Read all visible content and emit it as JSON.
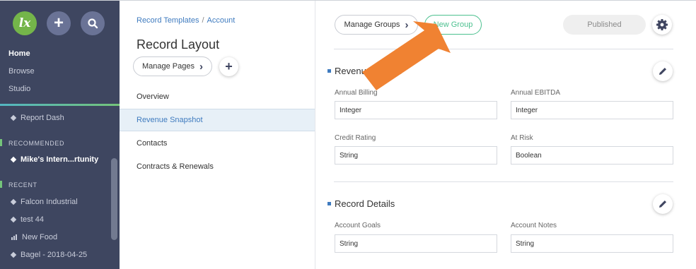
{
  "sidebar": {
    "logo_text": "lx",
    "nav": {
      "home": "Home",
      "browse": "Browse",
      "studio": "Studio"
    },
    "pinned": [
      {
        "label": "Report Dash"
      }
    ],
    "recommended_header": "RECOMMENDED",
    "recommended": [
      {
        "label": "Mike's Intern...rtunity"
      }
    ],
    "recent_header": "RECENT",
    "recent": [
      {
        "label": "Falcon Industrial",
        "icon": "diamond-icon"
      },
      {
        "label": "test 44",
        "icon": "diamond-icon"
      },
      {
        "label": "New Food",
        "icon": "bar-chart-icon"
      },
      {
        "label": "Bagel - 2018-04-25",
        "icon": "diamond-icon"
      }
    ]
  },
  "middle": {
    "breadcrumb": {
      "parent": "Record Templates",
      "separator": "/",
      "current": "Account"
    },
    "title": "Record Layout",
    "manage_pages_label": "Manage Pages",
    "pages": [
      {
        "label": "Overview"
      },
      {
        "label": "Revenue Snapshot"
      },
      {
        "label": "Contacts"
      },
      {
        "label": "Contracts & Renewals"
      }
    ],
    "selected_page": "Revenue Snapshot"
  },
  "main": {
    "manage_groups_label": "Manage Groups",
    "new_group_label": "New Group",
    "published_label": "Published",
    "groups": [
      {
        "title": "Revenue Details",
        "fields": [
          {
            "label": "Annual Billing",
            "type": "Integer"
          },
          {
            "label": "Annual EBITDA",
            "type": "Integer"
          },
          {
            "label": "Credit Rating",
            "type": "String"
          },
          {
            "label": "At Risk",
            "type": "Boolean"
          }
        ]
      },
      {
        "title": "Record Details",
        "fields": [
          {
            "label": "Account Goals",
            "type": "String"
          },
          {
            "label": "Account Notes",
            "type": "String"
          }
        ]
      }
    ]
  },
  "colors": {
    "sidebar_bg": "#3e4660",
    "logo_green": "#74b54a",
    "accent_blue": "#3f7bbf",
    "new_group_green": "#4cc08f",
    "annotation_orange": "#f08232"
  }
}
